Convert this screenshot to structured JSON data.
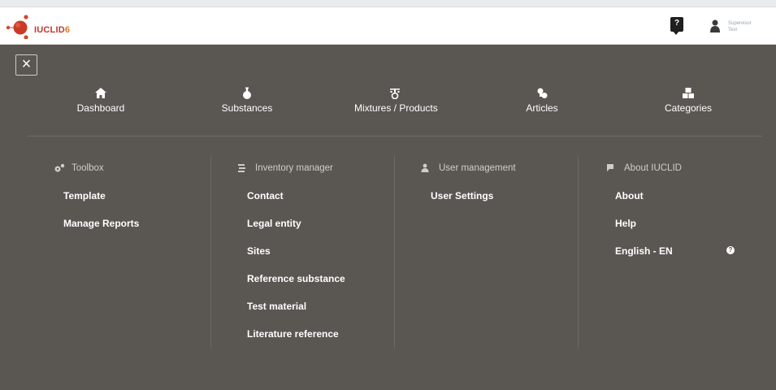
{
  "header": {
    "logo_text": "IUCLID",
    "logo_version": "6",
    "help_icon": "help-bubble-icon",
    "user_name": "Supervisor",
    "user_sub": "Test"
  },
  "menu": {
    "close_glyph": "×",
    "nav": [
      {
        "label": "Dashboard",
        "icon": "home-icon"
      },
      {
        "label": "Substances",
        "icon": "flask-icon"
      },
      {
        "label": "Mixtures / Products",
        "icon": "mixture-icon"
      },
      {
        "label": "Articles",
        "icon": "articles-icon"
      },
      {
        "label": "Categories",
        "icon": "categories-icon"
      }
    ],
    "columns": [
      {
        "title": "Toolbox",
        "icon": "gears-icon",
        "links": [
          "Template",
          "Manage Reports"
        ]
      },
      {
        "title": "Inventory manager",
        "icon": "books-icon",
        "links": [
          "Contact",
          "Legal entity",
          "Sites",
          "Reference substance",
          "Test material",
          "Literature reference"
        ]
      },
      {
        "title": "User management",
        "icon": "user-icon",
        "links": [
          "User Settings"
        ]
      },
      {
        "title": "About IUCLID",
        "icon": "comment-icon",
        "links": [
          "About",
          "Help",
          "English - EN"
        ]
      }
    ],
    "info_glyph": "?"
  },
  "colors": {
    "menu_bg": "#5a5652",
    "logo_red": "#c0392b",
    "logo_orange": "#e07a1f"
  }
}
